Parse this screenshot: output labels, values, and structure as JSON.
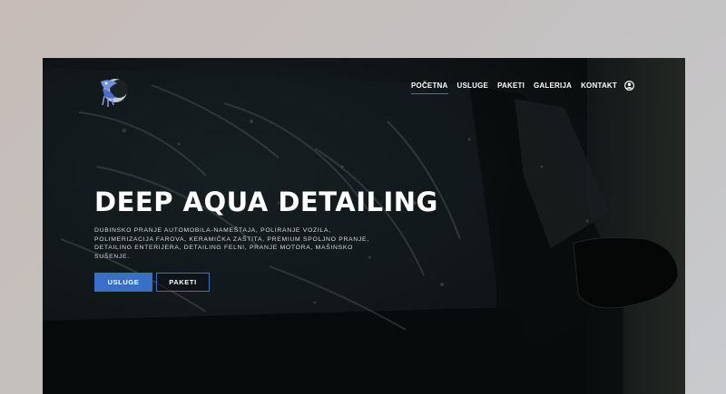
{
  "site": {
    "logo_icon": "deep-aqua-logo"
  },
  "nav": {
    "items": [
      {
        "label": "POČETNA",
        "active": true
      },
      {
        "label": "USLUGE",
        "active": false
      },
      {
        "label": "PAKETI",
        "active": false
      },
      {
        "label": "GALERIJA",
        "active": false
      },
      {
        "label": "KONTAKT",
        "active": false
      }
    ],
    "user_icon": "user-account-icon"
  },
  "hero": {
    "title": "DEEP AQUA DETAILING",
    "description": "Dubinsko pranje automobila-nameštaja, poliranje vozila, polimerizacija farova, keramička zaštita, premium spoljno pranje, detailing enterijera, detailing felni, pranje motora, mašinsko sušenje.",
    "primary_button": "USLUGE",
    "secondary_button": "PAKETI"
  },
  "colors": {
    "accent": "#3a6fc9",
    "page_background": "#c6c2c2",
    "hero_dark": "#0e1213"
  }
}
